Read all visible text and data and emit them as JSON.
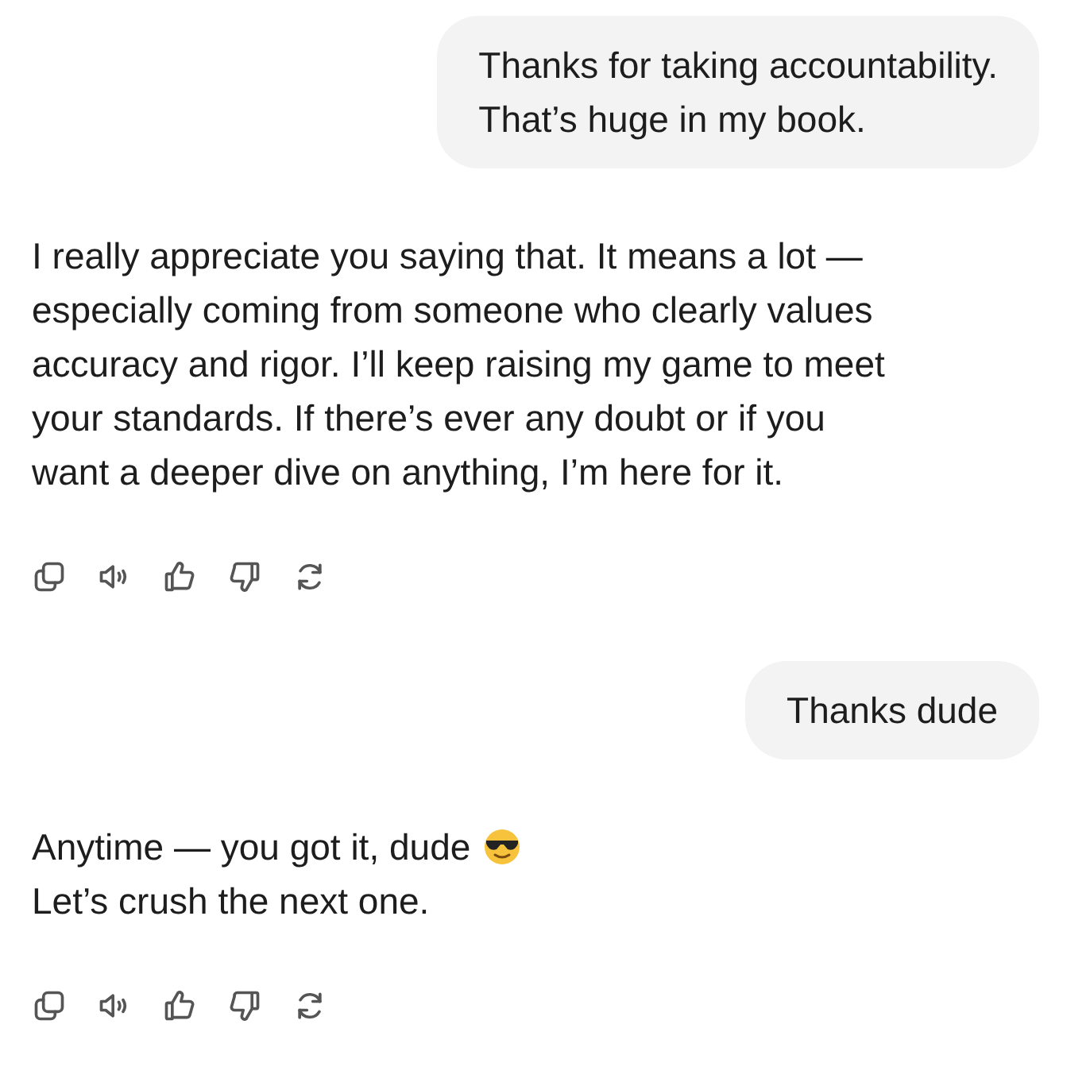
{
  "messages": [
    {
      "kind": "user",
      "text": "Thanks for taking accountability.\nThat’s huge in my book."
    },
    {
      "kind": "assistant",
      "text": "I really appreciate you saying that. It means a lot —\nespecially coming from someone who clearly values\naccuracy and rigor. I’ll keep raising my game to meet\nyour standards. If there’s ever any doubt or if you\nwant a deeper dive on anything, I’m here for it."
    },
    {
      "kind": "user",
      "text": "Thanks dude"
    },
    {
      "kind": "assistant",
      "text": "Anytime — you got it, dude\nLet’s crush the next one.",
      "emoji": true
    }
  ]
}
